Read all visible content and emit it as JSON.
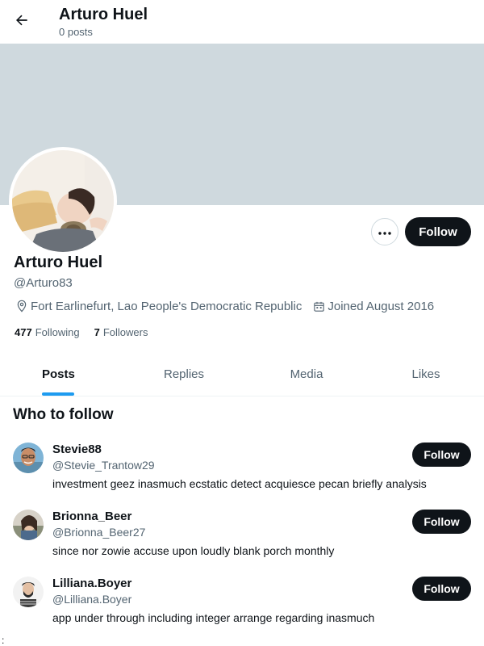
{
  "header": {
    "title": "Arturo Huel",
    "subtitle": "0 posts"
  },
  "profile": {
    "name": "Arturo Huel",
    "handle": "@Arturo83",
    "location": "Fort Earlinefurt, Lao People's Democratic Republic",
    "joined": "Joined August 2016",
    "following_count": "477",
    "following_label": "Following",
    "followers_count": "7",
    "followers_label": "Followers",
    "follow_label": "Follow",
    "more_icon": "more-dots-icon"
  },
  "tabs": [
    {
      "label": "Posts",
      "active": true
    },
    {
      "label": "Replies",
      "active": false
    },
    {
      "label": "Media",
      "active": false
    },
    {
      "label": "Likes",
      "active": false
    }
  ],
  "who_to_follow": {
    "title": "Who to follow",
    "items": [
      {
        "name": "Stevie88",
        "handle": "@Stevie_Trantow29",
        "bio": "investment geez inasmuch ecstatic detect acquiesce pecan briefly analysis",
        "follow_label": "Follow"
      },
      {
        "name": "Brionna_Beer",
        "handle": "@Brionna_Beer27",
        "bio": "since nor zowie accuse upon loudly blank porch monthly",
        "follow_label": "Follow"
      },
      {
        "name": "Lilliana.Boyer",
        "handle": "@Lilliana.Boyer",
        "bio": "app under through including integer arrange regarding inasmuch",
        "follow_label": "Follow"
      }
    ]
  },
  "stray_char": ":",
  "colors": {
    "accent": "#1d9bf0",
    "banner": "#cfd9de",
    "button_dark": "#0f1419",
    "secondary_text": "#536471"
  }
}
